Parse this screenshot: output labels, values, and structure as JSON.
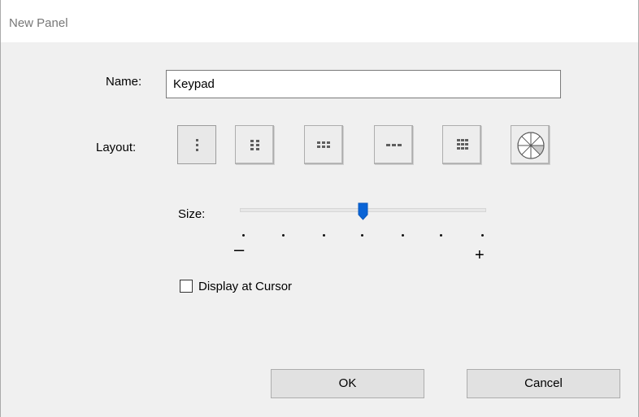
{
  "window": {
    "title": "New Panel"
  },
  "name": {
    "label": "Name:",
    "value": "Keypad"
  },
  "layout": {
    "label": "Layout:",
    "options": [
      {
        "icon": "one-column-dots-icon",
        "selected": true
      },
      {
        "icon": "two-column-dots-icon",
        "selected": false
      },
      {
        "icon": "three-column-dots-icon",
        "selected": false
      },
      {
        "icon": "single-row-dashes-icon",
        "selected": false
      },
      {
        "icon": "grid-dots-icon",
        "selected": false
      },
      {
        "icon": "pie-wheel-icon",
        "selected": false
      }
    ]
  },
  "size": {
    "label": "Size:",
    "min_label": "–",
    "max_label": "+",
    "tick_count": 7,
    "value_index": 3
  },
  "display_at_cursor": {
    "label": "Display at Cursor",
    "checked": false
  },
  "buttons": {
    "ok": "OK",
    "cancel": "Cancel"
  },
  "colors": {
    "accent": "#0a64d6",
    "dialog_bg": "#f0f0f0"
  }
}
